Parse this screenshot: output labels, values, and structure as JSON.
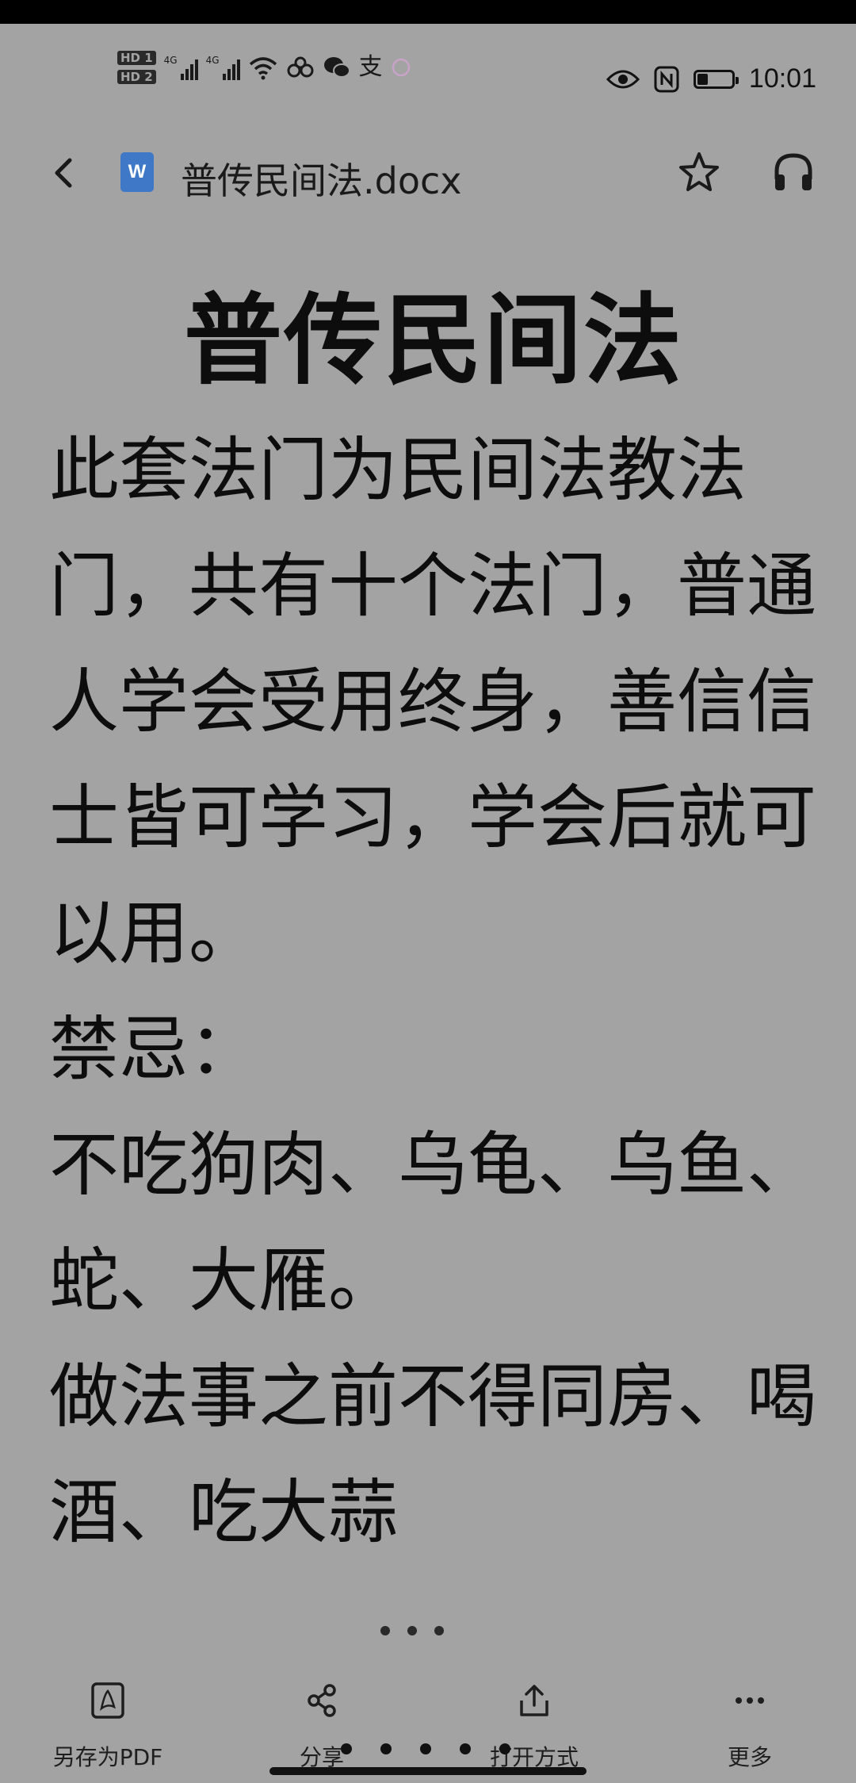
{
  "status_bar": {
    "sim1": "HD 1",
    "sim2": "HD 2",
    "net1": "4G",
    "net2": "4G",
    "alipay_glyph": "支",
    "battery_level": 0.3,
    "time": "10:01",
    "icons": [
      "signal-icon",
      "wifi-icon",
      "chain-icon",
      "wechat-icon",
      "alipay-icon",
      "circle-icon",
      "eye-icon",
      "nfc-icon",
      "battery-icon"
    ]
  },
  "app_bar": {
    "doc_type_letter": "W",
    "filename": "普传民间法.docx",
    "icons": [
      "back-icon",
      "word-doc-icon",
      "star-icon",
      "headphones-icon"
    ]
  },
  "document": {
    "title": "普传民间法",
    "paragraphs": [
      "此套法门为民间法教法门，共有十个法门，普通人学会受用终身，善信信士皆可学习，学会后就可以用。",
      "禁忌：",
      "不吃狗肉、乌龟、乌鱼、蛇、大雁。",
      "做法事之前不得同房、喝酒、吃大蒜"
    ]
  },
  "bottom_bar": {
    "save_pdf": "另存为PDF",
    "share": "分享",
    "open_with": "打开方式",
    "more": "更多"
  },
  "colors": {
    "background": "#a3a3a3",
    "text": "#0d0d0d",
    "word_blue": "#3f78c6"
  }
}
